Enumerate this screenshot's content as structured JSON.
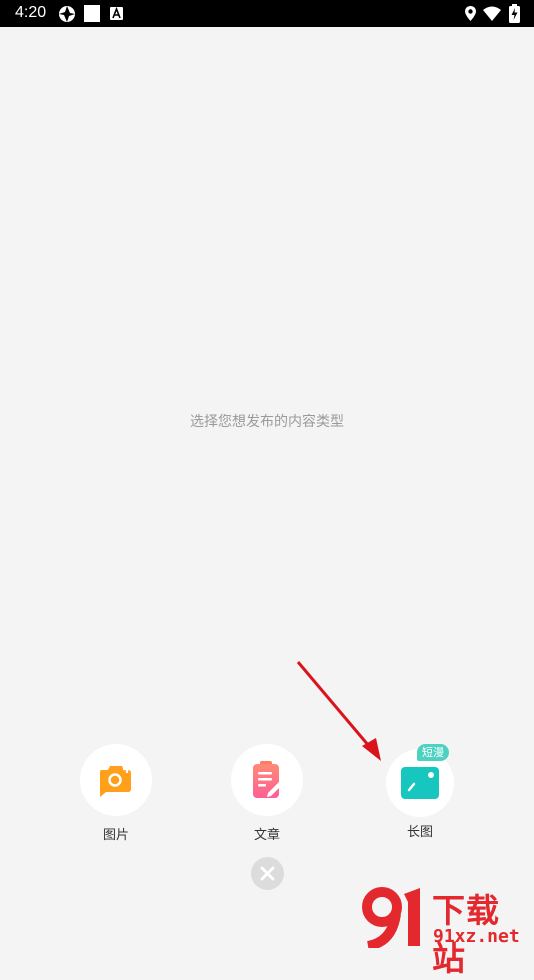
{
  "status_bar": {
    "time": "4:20",
    "left_icons": [
      "aperture-icon",
      "white-square-icon",
      "text-a-icon"
    ],
    "right_icons": [
      "location-icon",
      "wifi-icon",
      "battery-charging-icon"
    ]
  },
  "main": {
    "hint": "选择您想发布的内容类型"
  },
  "actions": [
    {
      "label": "图片",
      "icon": "camera-icon",
      "color": "#ff9f1a"
    },
    {
      "label": "文章",
      "icon": "article-edit-icon",
      "color": "#ff6f8e"
    },
    {
      "label": "长图",
      "icon": "long-image-icon",
      "color": "#18c6c0",
      "badge": "短漫"
    }
  ],
  "close_icon": "close-icon",
  "watermark": {
    "title": "下载站",
    "url": "91xz.net"
  }
}
